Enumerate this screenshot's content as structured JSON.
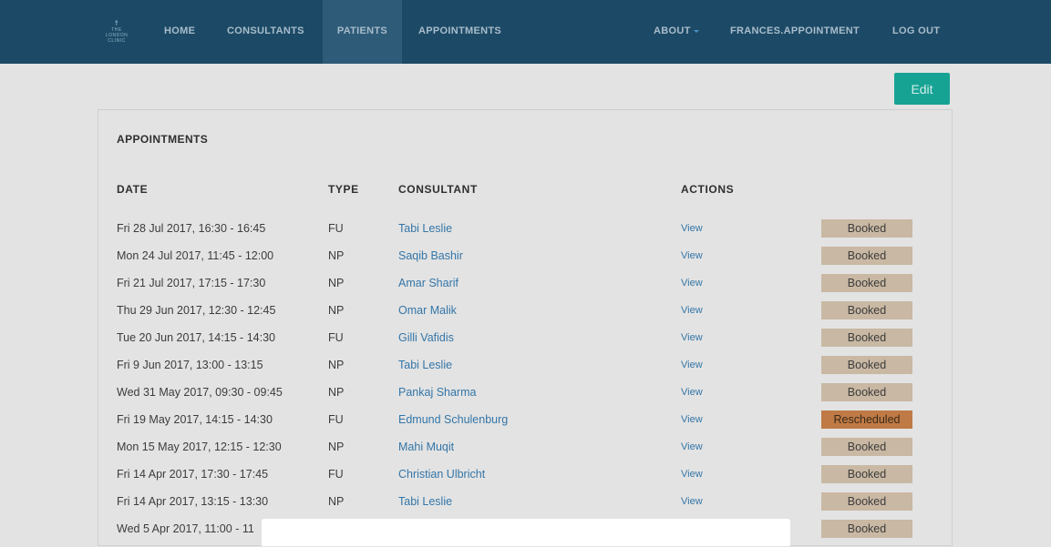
{
  "nav": {
    "logo_lines": [
      "THE",
      "LONDON",
      "CLINIC"
    ],
    "items": [
      {
        "label": "HOME"
      },
      {
        "label": "CONSULTANTS"
      },
      {
        "label": "PATIENTS"
      },
      {
        "label": "APPOINTMENTS"
      }
    ],
    "about": "ABOUT",
    "user": "FRANCES.APPOINTMENT",
    "logout": "LOG OUT",
    "active_item": "PATIENTS"
  },
  "toolbar": {
    "edit_label": "Edit"
  },
  "appointments": {
    "title": "APPOINTMENTS",
    "headers": {
      "date": "DATE",
      "type": "TYPE",
      "consultant": "CONSULTANT",
      "actions": "ACTIONS"
    },
    "rows": [
      {
        "date": "Fri 28 Jul 2017, 16:30 - 16:45",
        "type": "FU",
        "consultant": "Tabi Leslie",
        "action": "View",
        "status": "Booked"
      },
      {
        "date": "Mon 24 Jul 2017, 11:45 - 12:00",
        "type": "NP",
        "consultant": "Saqib Bashir",
        "action": "View",
        "status": "Booked"
      },
      {
        "date": "Fri 21 Jul 2017, 17:15 - 17:30",
        "type": "NP",
        "consultant": "Amar Sharif",
        "action": "View",
        "status": "Booked"
      },
      {
        "date": "Thu 29 Jun 2017, 12:30 - 12:45",
        "type": "NP",
        "consultant": "Omar Malik",
        "action": "View",
        "status": "Booked"
      },
      {
        "date": "Tue 20 Jun 2017, 14:15 - 14:30",
        "type": "FU",
        "consultant": "Gilli Vafidis",
        "action": "View",
        "status": "Booked"
      },
      {
        "date": "Fri 9 Jun 2017, 13:00 - 13:15",
        "type": "NP",
        "consultant": "Tabi Leslie",
        "action": "View",
        "status": "Booked"
      },
      {
        "date": "Wed 31 May 2017, 09:30 - 09:45",
        "type": "NP",
        "consultant": "Pankaj Sharma",
        "action": "View",
        "status": "Booked"
      },
      {
        "date": "Fri 19 May 2017, 14:15 - 14:30",
        "type": "FU",
        "consultant": "Edmund Schulenburg",
        "action": "View",
        "status": "Rescheduled"
      },
      {
        "date": "Mon 15 May 2017, 12:15 - 12:30",
        "type": "NP",
        "consultant": "Mahi Muqit",
        "action": "View",
        "status": "Booked"
      },
      {
        "date": "Fri 14 Apr 2017, 17:30 - 17:45",
        "type": "FU",
        "consultant": "Christian Ulbricht",
        "action": "View",
        "status": "Booked"
      },
      {
        "date": "Fri 14 Apr 2017, 13:15 - 13:30",
        "type": "NP",
        "consultant": "Tabi Leslie",
        "action": "View",
        "status": "Booked"
      },
      {
        "date": "Wed 5 Apr 2017, 11:00 - 11",
        "type": "",
        "consultant": "",
        "action": "",
        "status": "Booked"
      }
    ]
  },
  "colors": {
    "navbar": "#1c4a66",
    "accent_button": "#17a394",
    "link": "#3476a8",
    "status_booked": "#c9b8a3",
    "status_rescheduled": "#bf7a45"
  }
}
